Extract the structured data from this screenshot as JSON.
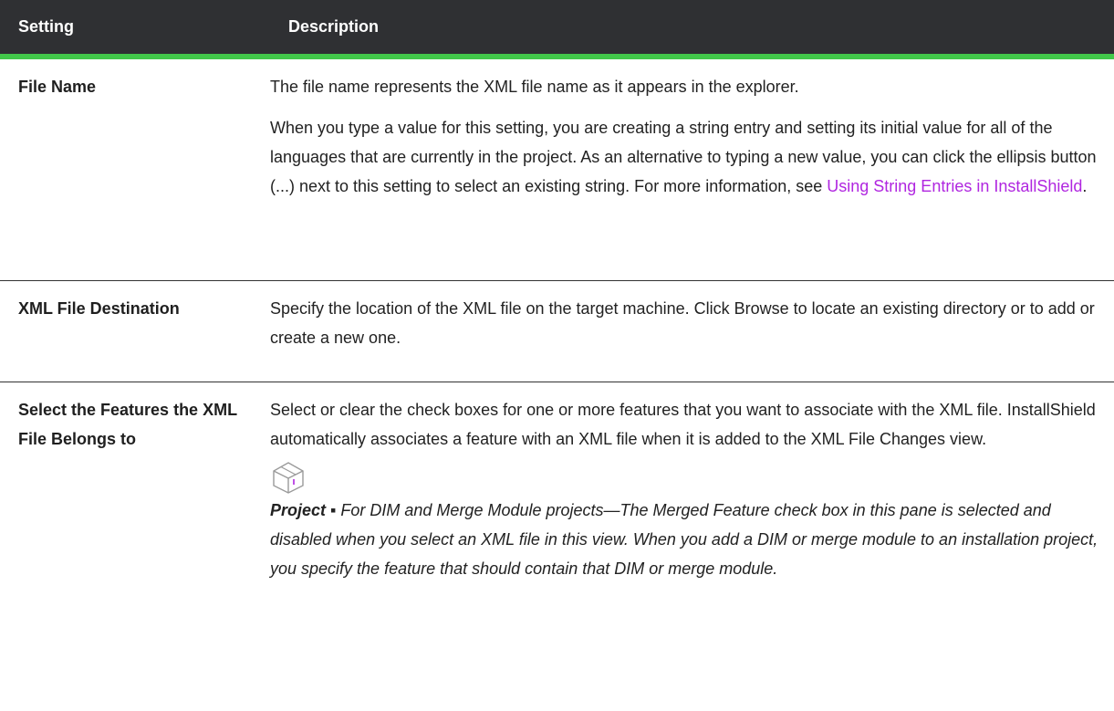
{
  "table": {
    "header": {
      "setting": "Setting",
      "description": "Description"
    },
    "rows": [
      {
        "name": "File Name",
        "p1": "The file name represents the XML file name as it appears in the explorer.",
        "p2_text": "When you type a value for this setting, you are creating a string entry and setting its initial value for all of the languages that are currently in the project. As an alternative to typing a new value, you can click the ellipsis button (...) next to this setting to select an existing string. For more information, see ",
        "p2_link": "Using String Entries in InstallShield",
        "p2_end": "."
      },
      {
        "name": "XML File Destination",
        "p1": "Specify the location of the XML file on the target machine. Click Browse to locate an existing directory or to add or create a new one."
      },
      {
        "name": "Select the Features the XML File Belongs to",
        "p1": "Select or clear the check boxes for one or more features that you want to associate with the XML file. InstallShield automatically associates a feature with an XML file when it is added to the XML File Changes view.",
        "note_icon": "project-box-icon",
        "note_label": "Project ▪ ",
        "note_text": "For DIM and Merge Module projects—The Merged Feature check box in this pane is selected and disabled when you select an XML file in this view. When you add a DIM or merge module to an installation project, you specify the feature that should contain that DIM or merge module."
      }
    ]
  },
  "colors": {
    "header_bg": "#2f3033",
    "header_accent": "#42c84a",
    "link": "#b026e0"
  }
}
